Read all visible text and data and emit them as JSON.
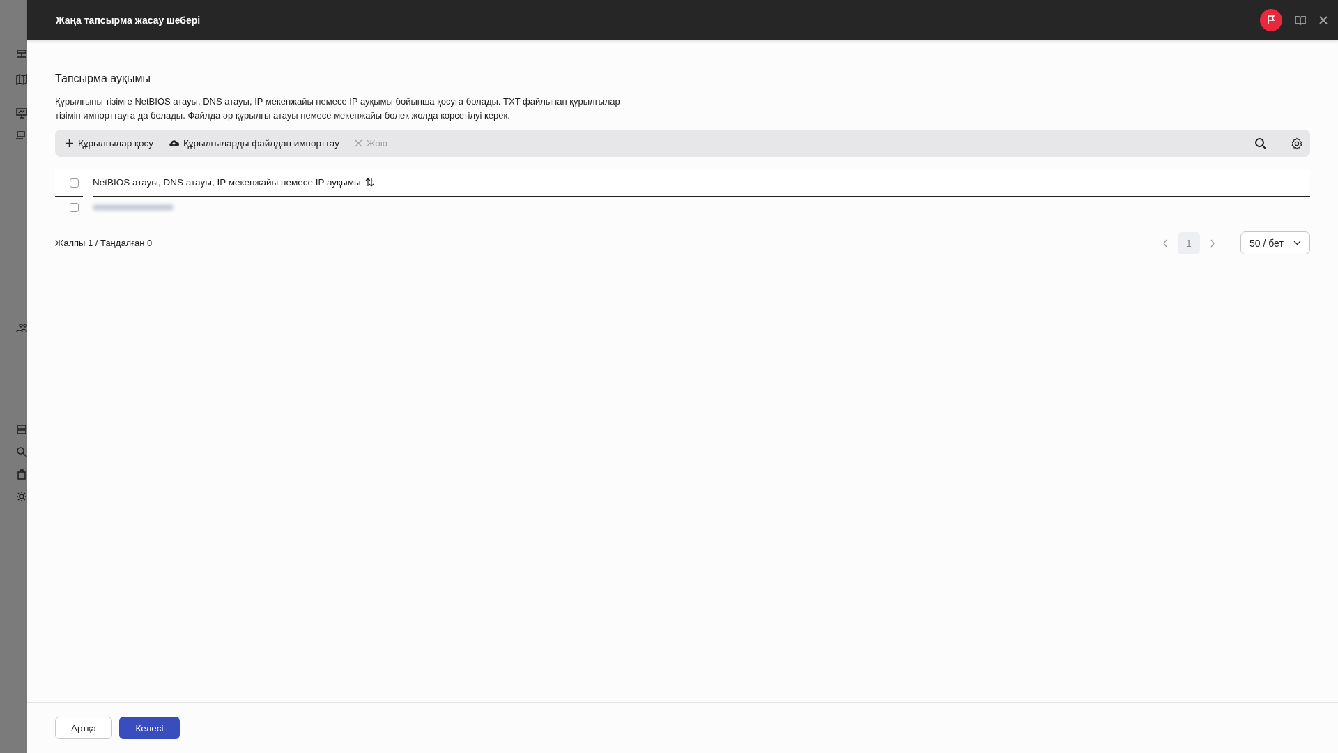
{
  "window": {
    "title": "Жаңа тапсырма жасау шебері"
  },
  "section": {
    "title": "Тапсырма ауқымы",
    "description": "Құрылғыны тізімге NetBIOS атауы, DNS атауы, IP мекенжайы немесе IP ауқымы бойынша қосуға болады. TXT файлынан құрылғылар тізімін импорттауға да болады. Файлда әр құрылғы атауы немесе мекенжайы бөлек жолда көрсетілуі керек."
  },
  "toolbar": {
    "actions": [
      {
        "kind": "add",
        "label": "Құрылғылар қосу",
        "disabled": false
      },
      {
        "kind": "import",
        "label": "Құрылғыларды файлдан импорттау",
        "disabled": false
      },
      {
        "kind": "delete",
        "label": "Жою",
        "disabled": true
      }
    ]
  },
  "table": {
    "select_all_checked": false,
    "columns": [
      {
        "label": "NetBIOS атауы, DNS атауы, IP мекенжайы немесе IP ауқымы",
        "sortable": true
      }
    ],
    "rows": [
      {
        "checked": false,
        "kind": "redacted"
      }
    ]
  },
  "summary": "Жалпы 1 / Таңдалған 0",
  "pagination": {
    "pages": [
      {
        "label": "1",
        "selected": true
      }
    ],
    "page_size": "50 / бет"
  },
  "buttons": [
    {
      "label": "Артқа",
      "kind": "secondary"
    },
    {
      "label": "Келесі",
      "kind": "primary"
    }
  ]
}
